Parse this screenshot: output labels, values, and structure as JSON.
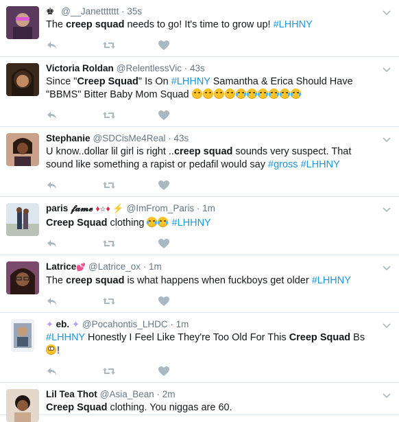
{
  "tweets": [
    {
      "name": "",
      "name_prefix": "♚",
      "handle": "@__Janettttttt",
      "time": "35s",
      "body": [
        {
          "t": "The "
        },
        {
          "t": "creep squad",
          "b": true
        },
        {
          "t": " needs to go! It's time to grow up!  "
        },
        {
          "t": "#LHHNY",
          "tag": true
        }
      ]
    },
    {
      "name": "Victoria Roldan",
      "handle": "@RelentlessVic",
      "time": "43s",
      "body": [
        {
          "t": "Since \""
        },
        {
          "t": "Creep Squad",
          "b": true
        },
        {
          "t": "\" Is On "
        },
        {
          "t": "#LHHNY",
          "tag": true
        },
        {
          "t": " Samantha & Erica Should Have \"BBMS\" Bitter Baby Mom Squad "
        }
      ]
    },
    {
      "name": "Stephanie",
      "handle": "@SDCisMe4Real",
      "time": "43s",
      "body": [
        {
          "t": "U know..dollar lil girl is right .."
        },
        {
          "t": "creep squad",
          "b": true
        },
        {
          "t": " sounds very suspect. That sound like something a rapist or pedafil would say "
        },
        {
          "t": "#gross",
          "tag": true
        },
        {
          "t": "  "
        },
        {
          "t": "#LHHNY",
          "tag": true
        }
      ]
    },
    {
      "name": "paris 𝓯𝓪𝓶𝓮",
      "handle": "@ImFrom_Paris",
      "time": "1m",
      "body": [
        {
          "t": "Creep Squad",
          "b": true
        },
        {
          "t": " clothing "
        },
        {
          "t": " "
        },
        {
          "t": "#LHHNY",
          "tag": true
        }
      ]
    },
    {
      "name": "Latrice",
      "handle": "@Latrice_ox",
      "time": "1m",
      "body": [
        {
          "t": "The "
        },
        {
          "t": "creep squad",
          "b": true
        },
        {
          "t": " is what happens when fuckboys get older "
        },
        {
          "t": "#LHHNY",
          "tag": true
        }
      ]
    },
    {
      "name": "eb.",
      "handle": "@Pocahontis_LHDC",
      "time": "1m",
      "body": [
        {
          "t": "#LHHNY",
          "tag": true
        },
        {
          "t": " Honestly I Feel Like They're Too Old For This "
        },
        {
          "t": "Creep Squad",
          "b": true
        },
        {
          "t": " Bs "
        }
      ]
    },
    {
      "name": "Lil Tea Thot",
      "handle": "@Asia_Bean",
      "time": "2m",
      "body": [
        {
          "t": "Creep Squad",
          "b": true
        },
        {
          "t": " clothing. You niggas are 60."
        }
      ]
    }
  ],
  "colors": {
    "link": "#1b95e0",
    "muted": "#657786",
    "action_icon": "#aab8c2",
    "divider": "#e1e8ed"
  },
  "icons": {
    "reply": "reply-icon",
    "retweet": "retweet-icon",
    "like": "heart-icon",
    "more": "chevron-down-icon"
  }
}
